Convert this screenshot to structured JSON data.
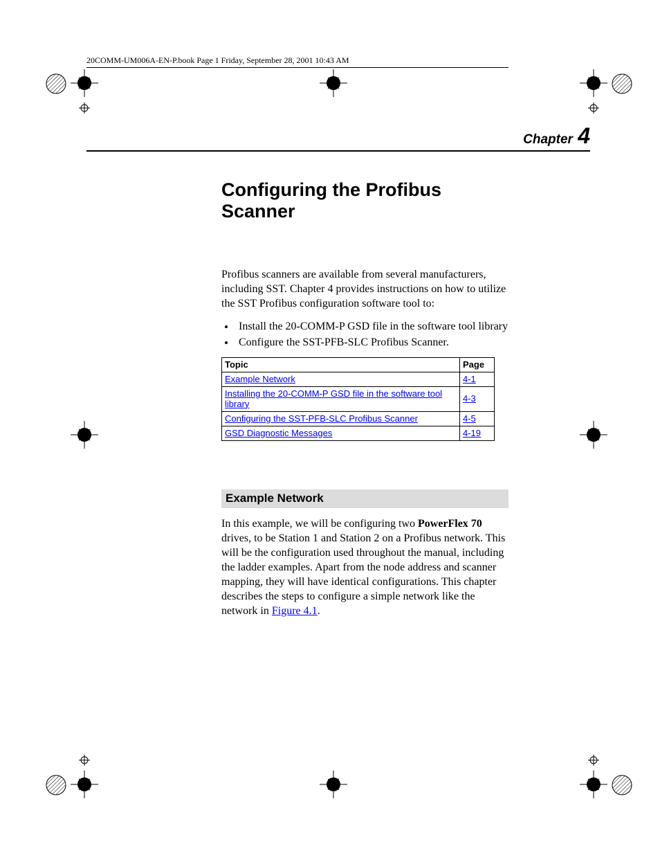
{
  "header": {
    "line": "20COMM-UM006A-EN-P.book  Page 1  Friday, September 28, 2001  10:43 AM"
  },
  "chapter": {
    "label": "Chapter",
    "number": "4"
  },
  "title": "Configuring the Profibus Scanner",
  "intro": "Profibus scanners are available from several manufacturers, including SST. Chapter 4 provides instructions on how to utilize the SST Profibus configuration software tool to:",
  "bullets": [
    "Install the 20-COMM-P GSD file in the software tool library",
    "Configure the SST-PFB-SLC Profibus Scanner."
  ],
  "toc": {
    "headers": {
      "topic": "Topic",
      "page": "Page"
    },
    "rows": [
      {
        "topic": "Example Network",
        "page": "4-1"
      },
      {
        "topic": "Installing the 20-COMM-P GSD file in the software tool library",
        "page": "4-3"
      },
      {
        "topic": "Configuring the SST-PFB-SLC Profibus Scanner",
        "page": "4-5"
      },
      {
        "topic": "GSD Diagnostic Messages",
        "page": "4-19"
      }
    ]
  },
  "section": {
    "heading": "Example Network",
    "p1_a": "In this example, we will be configuring two ",
    "p1_bold": "PowerFlex 70",
    "p1_b": " drives, to be Station 1 and Station 2 on a Profibus network. This will be the configuration used throughout the manual, including the ladder examples. Apart from the node address and scanner mapping, they will have identical configurations. This chapter describes the steps to configure a simple network like the network in ",
    "p1_link": "Figure 4.1",
    "p1_c": "."
  }
}
